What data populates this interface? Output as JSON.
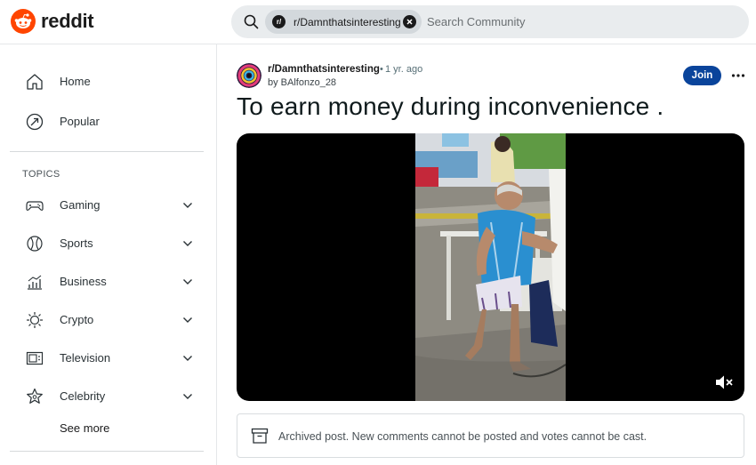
{
  "header": {
    "logo_text": "reddit",
    "search": {
      "chip_avatar": "r/",
      "chip_label": "r/Damnthatsinteresting",
      "placeholder": "Search Community"
    }
  },
  "sidebar": {
    "nav": [
      {
        "label": "Home",
        "icon": "home-icon"
      },
      {
        "label": "Popular",
        "icon": "popular-icon"
      }
    ],
    "topics_title": "TOPICS",
    "topics": [
      {
        "label": "Gaming",
        "icon": "gamepad-icon"
      },
      {
        "label": "Sports",
        "icon": "ball-icon"
      },
      {
        "label": "Business",
        "icon": "chart-icon"
      },
      {
        "label": "Crypto",
        "icon": "crypto-icon"
      },
      {
        "label": "Television",
        "icon": "tv-icon"
      },
      {
        "label": "Celebrity",
        "icon": "star-icon"
      }
    ],
    "see_more": "See more"
  },
  "post": {
    "subreddit": "r/Damnthatsinteresting",
    "dot": "•",
    "time": "1 yr. ago",
    "author": "by BAlfonzo_28",
    "join_label": "Join",
    "title": "To earn money during inconvenience .",
    "archived_text": "Archived post. New comments cannot be posted and votes cannot be cast."
  },
  "colors": {
    "brand": "#ff4500",
    "join": "#0a449b",
    "search_bg": "#e9ecee"
  }
}
